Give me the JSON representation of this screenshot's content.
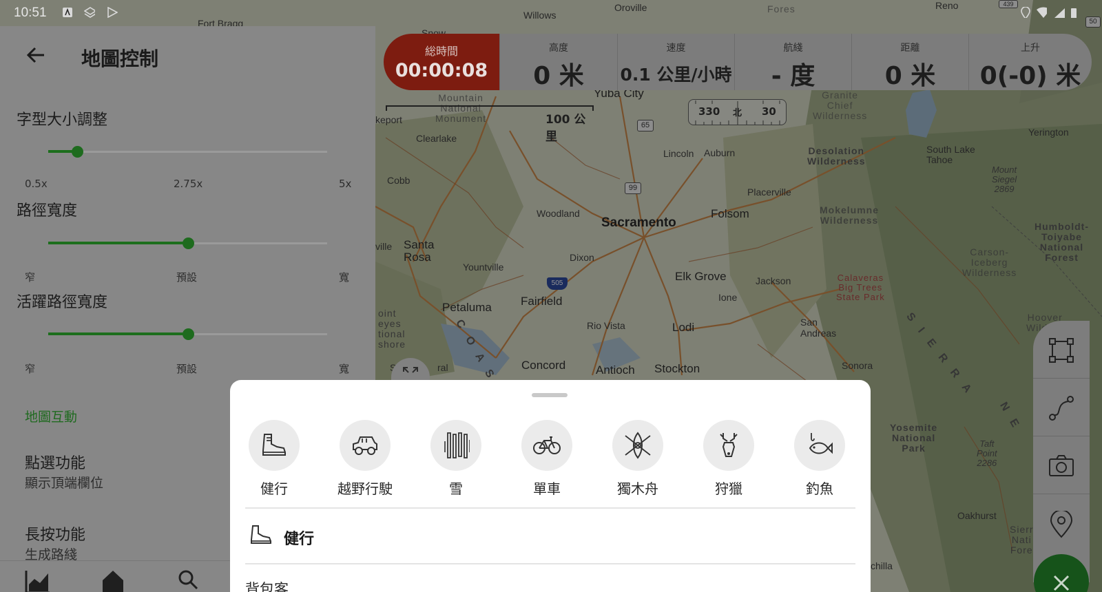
{
  "status_bar": {
    "time": "10:51",
    "icons": [
      "app-a-icon",
      "layers-icon",
      "play-store-icon",
      "location-icon",
      "wifi-icon",
      "signal-icon",
      "battery-icon"
    ]
  },
  "panel": {
    "title": "地圖控制",
    "font_size": {
      "label": "字型大小調整",
      "ticks": [
        "0.5x",
        "2.75x",
        "5x"
      ],
      "value": 0.5
    },
    "path_width": {
      "label": "路徑寬度",
      "ticks": [
        "窄",
        "預設",
        "寬"
      ],
      "value": "預設"
    },
    "active_path_width": {
      "label": "活躍路徑寬度",
      "ticks": [
        "窄",
        "預設",
        "寬"
      ],
      "value": "預設"
    },
    "map_interaction_label": "地圖互動",
    "tap": {
      "title": "點選功能",
      "subtitle": "顯示頂端欄位"
    },
    "long_press": {
      "title": "長按功能",
      "subtitle": "生成路綫"
    },
    "bottom_nav": [
      "stats-icon",
      "home-icon",
      "search-icon"
    ]
  },
  "stats": {
    "total_time": {
      "label": "総時間",
      "value": "00:00:08"
    },
    "cells": [
      {
        "label": "高度",
        "value": "0 米"
      },
      {
        "label": "速度",
        "value": "0.1 公里/小時"
      },
      {
        "label": "航綫",
        "value": "- 度"
      },
      {
        "label": "距離",
        "value": "0 米"
      },
      {
        "label": "上升",
        "value": "0(-0) 米"
      }
    ]
  },
  "map": {
    "scale_label": "100 公里",
    "compass": {
      "left": "330",
      "center": "北",
      "right": "30"
    },
    "labels": {
      "sacramento": "Sacramento",
      "folsom": "Folsom",
      "elk_grove": "Elk Grove",
      "lodi": "Lodi",
      "stockton": "Stockton",
      "antioch": "Antioch",
      "concord": "Concord",
      "fairfield": "Fairfield",
      "petaluma": "Petaluma",
      "santa_rosa": "Santa\nRosa",
      "yuba_city": "Yuba City",
      "woodland": "Woodland",
      "dixon": "Dixon",
      "rio_vista": "Rio Vista",
      "yountville": "Yountville",
      "lincoln": "Lincoln",
      "auburn": "Auburn",
      "placerville": "Placerville",
      "jackson": "Jackson",
      "ione": "Ione",
      "san_andreas": "San\nAndreas",
      "sonora": "Sonora",
      "oakhurst": "Oakhurst",
      "clearlake": "Clearlake",
      "cobb": "Cobb",
      "willows": "Willows",
      "oroville": "Oroville",
      "reno": "Reno",
      "yerington": "Yerington",
      "south_lake_tahoe": "South Lake\nTahoe",
      "fort_bragg": "Fort Bragg",
      "kport": "keport",
      "ville": "ville",
      "snow": "Snow",
      "chilla": "chilla",
      "desolation": "Desolation\nWilderness",
      "mokelumne": "Mokelumne\nWilderness",
      "yosemite": "Yosemite\nNational\nPark",
      "humboldt": "Humboldt-\nToiyabe\nNational\nForest",
      "carson": "Carson-\nIceberg\nWilderness",
      "calaveras": "Calaveras\nBig Trees\nState Park",
      "hoover": "Hoover\nWildern",
      "granite": "Granite\nChief\nWilderness",
      "mountain_monument": "Mountain\nNational\nMonument",
      "point_reyes": "oint\neyes\ntional\nshore",
      "mount_siegel": "Mount\nSiegel\n2869",
      "taft_point": "Taft\nPoint\n2286",
      "sierra_nat": "Sierr\nNati\nFore",
      "sierra": "S I E R R A",
      "coast": "C O A S T",
      "nev": "N E",
      "forest_top": "Fores",
      "route_65": "65",
      "route_99": "99",
      "route_505": "505",
      "route_50": "50",
      "route_439": "439",
      "ral": "ral",
      "sa": "S"
    }
  },
  "activities": {
    "items": [
      {
        "label": "健行",
        "icon": "hiking-boot-icon"
      },
      {
        "label": "越野行駛",
        "icon": "offroad-jeep-icon"
      },
      {
        "label": "雪",
        "icon": "skis-icon"
      },
      {
        "label": "單車",
        "icon": "bicycle-icon"
      },
      {
        "label": "獨木舟",
        "icon": "kayak-icon"
      },
      {
        "label": "狩獵",
        "icon": "deer-icon"
      },
      {
        "label": "釣魚",
        "icon": "fish-icon"
      }
    ],
    "selected": {
      "label": "健行",
      "icon": "hiking-boot-icon"
    },
    "sub_item": "背包客"
  },
  "colors": {
    "accent_green": "#1e6b1e",
    "timer_red": "#7d1c10",
    "sheet_bg": "#ffffff"
  }
}
